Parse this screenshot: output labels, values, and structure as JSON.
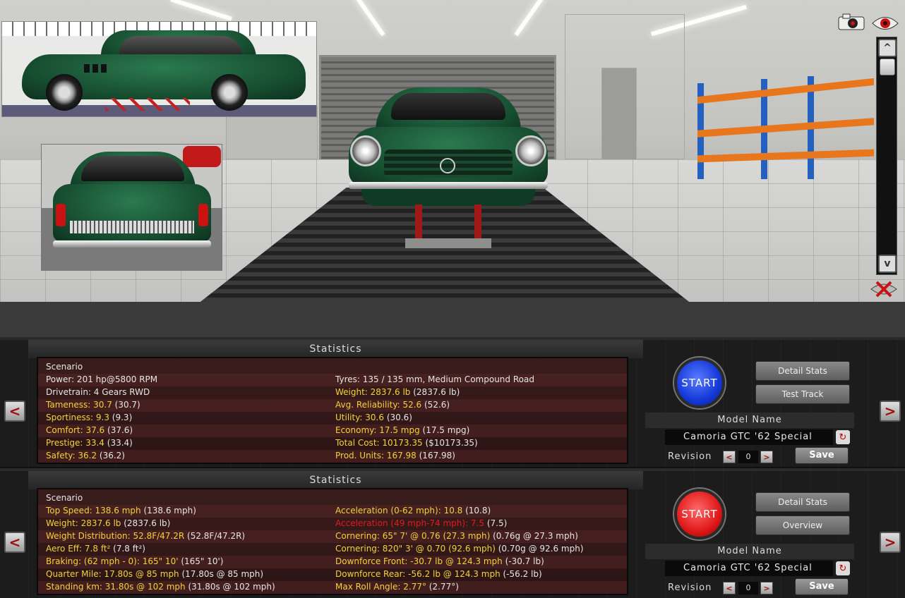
{
  "viewport": {
    "icons": [
      "camera-icon",
      "eye-icon",
      "close-x-icon"
    ],
    "scroll_up": "^",
    "scroll_down": "v"
  },
  "panels": [
    {
      "title": "Statistics",
      "rows": [
        {
          "left": [
            {
              "t": "Scenario",
              "c": "w"
            }
          ],
          "right": []
        },
        {
          "left": [
            {
              "t": "Power: 201 hp@5800 RPM",
              "c": "w"
            }
          ],
          "right": [
            {
              "t": "Tyres: 135 / 135 mm, Medium Compound Road",
              "c": "w"
            }
          ]
        },
        {
          "left": [
            {
              "t": "Drivetrain: 4 Gears RWD",
              "c": "w"
            }
          ],
          "right": [
            {
              "t": "Weight: 2837.6 lb",
              "c": "y"
            },
            {
              "t": " (2837.6 lb)",
              "c": "w"
            }
          ]
        },
        {
          "left": [
            {
              "t": "Tameness: 30.7",
              "c": "y"
            },
            {
              "t": " (30.7)",
              "c": "w"
            }
          ],
          "right": [
            {
              "t": "Avg. Reliability: 52.6",
              "c": "y"
            },
            {
              "t": " (52.6)",
              "c": "w"
            }
          ]
        },
        {
          "left": [
            {
              "t": "Sportiness: 9.3",
              "c": "y"
            },
            {
              "t": " (9.3)",
              "c": "w"
            }
          ],
          "right": [
            {
              "t": "Utility: 30.6",
              "c": "y"
            },
            {
              "t": " (30.6)",
              "c": "w"
            }
          ]
        },
        {
          "left": [
            {
              "t": "Comfort: 37.6",
              "c": "y"
            },
            {
              "t": " (37.6)",
              "c": "w"
            }
          ],
          "right": [
            {
              "t": "Economy: 17.5 mpg",
              "c": "y"
            },
            {
              "t": " (17.5 mpg)",
              "c": "w"
            }
          ]
        },
        {
          "left": [
            {
              "t": "Prestige: 33.4",
              "c": "y"
            },
            {
              "t": " (33.4)",
              "c": "w"
            }
          ],
          "right": [
            {
              "t": "Total Cost: 10173.35",
              "c": "y"
            },
            {
              "t": " ($10173.35)",
              "c": "w"
            }
          ]
        },
        {
          "left": [
            {
              "t": "Safety: 36.2",
              "c": "y"
            },
            {
              "t": " (36.2)",
              "c": "w"
            }
          ],
          "right": [
            {
              "t": "Prod. Units: 167.98",
              "c": "y"
            },
            {
              "t": " (167.98)",
              "c": "w"
            }
          ]
        }
      ],
      "start_label": "START",
      "start_color": "#1438d8",
      "btn1_label": "Detail Stats",
      "btn2_label": "Test Track",
      "model_name_label": "Model Name",
      "model_name_value": "Camoria GTC '62 Special",
      "revision_label": "Revision",
      "revision_value": "0",
      "save_label": "Save"
    },
    {
      "title": "Statistics",
      "rows": [
        {
          "left": [
            {
              "t": "Scenario",
              "c": "w"
            }
          ],
          "right": []
        },
        {
          "left": [
            {
              "t": "Top Speed: 138.6 mph",
              "c": "y"
            },
            {
              "t": " (138.6 mph)",
              "c": "w"
            }
          ],
          "right": [
            {
              "t": "Acceleration (0-62 mph): 10.8",
              "c": "y"
            },
            {
              "t": " (10.8)",
              "c": "w"
            }
          ]
        },
        {
          "left": [
            {
              "t": "Weight: 2837.6 lb",
              "c": "y"
            },
            {
              "t": " (2837.6 lb)",
              "c": "w"
            }
          ],
          "right": [
            {
              "t": "Acceleration (49 mph-74 mph): 7.5",
              "c": "r"
            },
            {
              "t": " (7.5)",
              "c": "w"
            }
          ]
        },
        {
          "left": [
            {
              "t": "Weight Distribution: 52.8F/47.2R",
              "c": "y"
            },
            {
              "t": " (52.8F/47.2R)",
              "c": "w"
            }
          ],
          "right": [
            {
              "t": "Cornering: 65\" 7' @ 0.76 (27.3 mph)",
              "c": "y"
            },
            {
              "t": " (0.76g @ 27.3 mph)",
              "c": "w"
            }
          ]
        },
        {
          "left": [
            {
              "t": "Aero Eff: 7.8 ft²",
              "c": "y"
            },
            {
              "t": " (7.8 ft²)",
              "c": "w"
            }
          ],
          "right": [
            {
              "t": "Cornering: 820\" 3' @ 0.70 (92.6 mph)",
              "c": "y"
            },
            {
              "t": " (0.70g @ 92.6 mph)",
              "c": "w"
            }
          ]
        },
        {
          "left": [
            {
              "t": "Braking: (62 mph - 0): 165\" 10'",
              "c": "y"
            },
            {
              "t": " (165\" 10')",
              "c": "w"
            }
          ],
          "right": [
            {
              "t": "Downforce Front: -30.7 lb @ 124.3 mph",
              "c": "y"
            },
            {
              "t": " (-30.7 lb)",
              "c": "w"
            }
          ]
        },
        {
          "left": [
            {
              "t": "Quarter Mile: 17.80s @ 85 mph",
              "c": "y"
            },
            {
              "t": " (17.80s @ 85 mph)",
              "c": "w"
            }
          ],
          "right": [
            {
              "t": "Downforce Rear: -56.2 lb @ 124.3 mph",
              "c": "y"
            },
            {
              "t": " (-56.2 lb)",
              "c": "w"
            }
          ]
        },
        {
          "left": [
            {
              "t": "Standing km: 31.80s @ 102 mph",
              "c": "y"
            },
            {
              "t": " (31.80s @ 102 mph)",
              "c": "w"
            }
          ],
          "right": [
            {
              "t": "Max Roll Angle: 2.77°",
              "c": "y"
            },
            {
              "t": " (2.77°)",
              "c": "w"
            }
          ]
        }
      ],
      "start_label": "START",
      "start_color": "#e01818",
      "btn1_label": "Detail Stats",
      "btn2_label": "Overview",
      "model_name_label": "Model Name",
      "model_name_value": "Camoria GTC '62 Special",
      "revision_label": "Revision",
      "revision_value": "0",
      "save_label": "Save"
    }
  ],
  "nav": {
    "prev": "<",
    "next": ">"
  },
  "colors": {
    "highlight": "#f3d23a",
    "warning": "#e01c1c",
    "car_green": "#1f6b43"
  }
}
